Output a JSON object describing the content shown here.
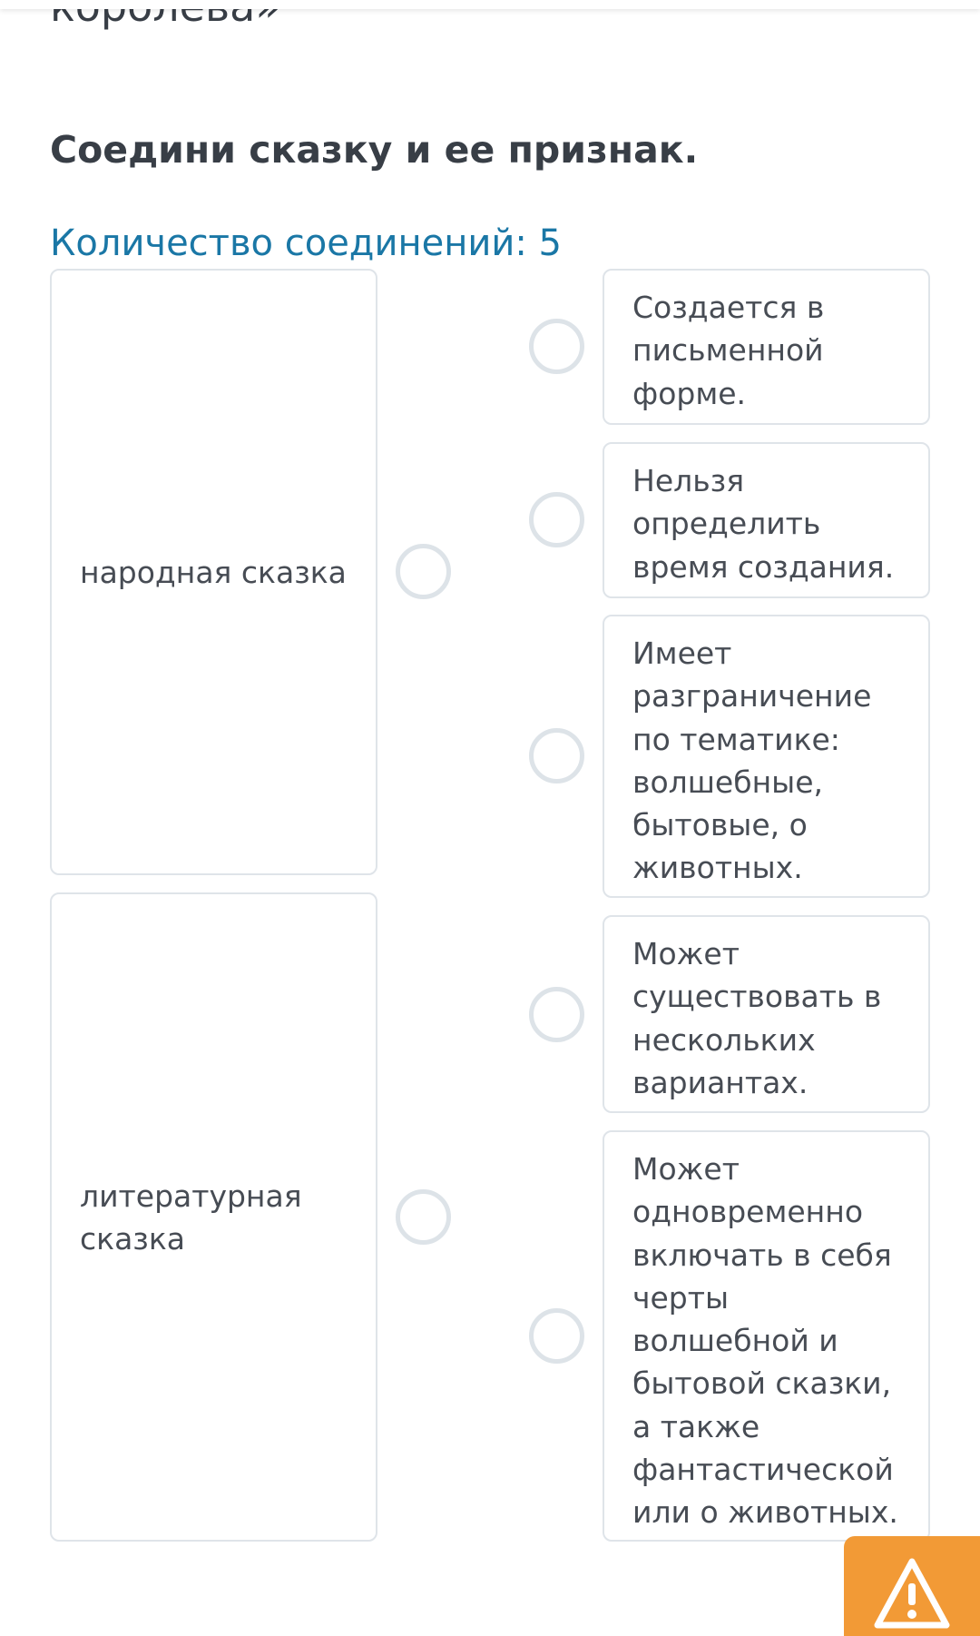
{
  "page": {
    "cut_title": "королева»",
    "question": "Соедини сказку и ее признак.",
    "connections_count": "Количество соединений: 5"
  },
  "left_items": [
    {
      "label": "народная сказка"
    },
    {
      "label": "литературная сказка"
    }
  ],
  "right_items": [
    {
      "label": "Создается в письменной форме."
    },
    {
      "label": "Нельзя определить время создания."
    },
    {
      "label": "Имеет разграничение по тематике: волшебные, бытовые, о животных."
    },
    {
      "label": "Может существовать в нескольких вариантах."
    },
    {
      "label": "Может одновременно включать в себя черты волшебной и бытовой сказки, а также фантастической или о животных."
    }
  ],
  "colors": {
    "accent_blue": "#1a77a6",
    "text_dark": "#383e46",
    "card_border": "#dfe4e9",
    "radio_border": "#dde3e8",
    "warning_orange": "#f29a36"
  },
  "icons": {
    "report_button": "warning-triangle-icon"
  }
}
